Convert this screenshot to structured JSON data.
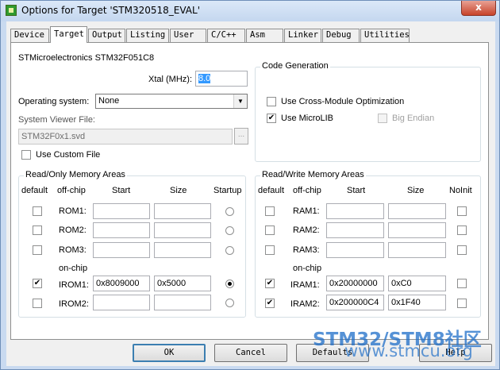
{
  "window": {
    "title": "Options for Target 'STM320518_EVAL'",
    "close_glyph": "x"
  },
  "tabs": [
    {
      "label": "Device",
      "active": false
    },
    {
      "label": "Target",
      "active": true
    },
    {
      "label": "Output",
      "active": false
    },
    {
      "label": "Listing",
      "active": false
    },
    {
      "label": "User",
      "active": false
    },
    {
      "label": "C/C++",
      "active": false
    },
    {
      "label": "Asm",
      "active": false
    },
    {
      "label": "Linker",
      "active": false
    },
    {
      "label": "Debug",
      "active": false
    },
    {
      "label": "Utilities",
      "active": false
    }
  ],
  "target": {
    "device_name": "STMicroelectronics STM32F051C8",
    "xtal_label": "Xtal (MHz):",
    "xtal_value": "8.0",
    "os_label": "Operating system:",
    "os_value": "None",
    "svf_label": "System Viewer File:",
    "svf_value": "STM32F0x1.svd",
    "browse_label": "...",
    "use_custom_file_label": "Use Custom File",
    "use_custom_file_checked": false
  },
  "code_generation": {
    "title": "Code Generation",
    "cross_module_label": "Use Cross-Module Optimization",
    "cross_module_checked": false,
    "microlib_label": "Use MicroLIB",
    "microlib_checked": true,
    "big_endian_label": "Big Endian",
    "big_endian_checked": false
  },
  "rom_areas": {
    "title": "Read/Only Memory Areas",
    "headers": {
      "default": "default",
      "offchip": "off-chip",
      "start": "Start",
      "size": "Size",
      "last": "Startup"
    },
    "onchip_label": "on-chip",
    "rows": [
      {
        "name": "ROM1:",
        "default": false,
        "start": "",
        "size": "",
        "selected": false
      },
      {
        "name": "ROM2:",
        "default": false,
        "start": "",
        "size": "",
        "selected": false
      },
      {
        "name": "ROM3:",
        "default": false,
        "start": "",
        "size": "",
        "selected": false
      },
      {
        "name": "IROM1:",
        "default": true,
        "start": "0x8009000",
        "size": "0x5000",
        "selected": true
      },
      {
        "name": "IROM2:",
        "default": false,
        "start": "",
        "size": "",
        "selected": false
      }
    ]
  },
  "ram_areas": {
    "title": "Read/Write Memory Areas",
    "headers": {
      "default": "default",
      "offchip": "off-chip",
      "start": "Start",
      "size": "Size",
      "last": "NoInit"
    },
    "onchip_label": "on-chip",
    "rows": [
      {
        "name": "RAM1:",
        "default": false,
        "start": "",
        "size": "",
        "noinit": false
      },
      {
        "name": "RAM2:",
        "default": false,
        "start": "",
        "size": "",
        "noinit": false
      },
      {
        "name": "RAM3:",
        "default": false,
        "start": "",
        "size": "",
        "noinit": false
      },
      {
        "name": "IRAM1:",
        "default": true,
        "start": "0x20000000",
        "size": "0xC0",
        "noinit": false
      },
      {
        "name": "IRAM2:",
        "default": true,
        "start": "0x200000C4",
        "size": "0x1F40",
        "noinit": false
      }
    ]
  },
  "buttons": {
    "ok": "OK",
    "cancel": "Cancel",
    "defaults": "Defaults",
    "help": "Help"
  },
  "watermark": {
    "line1": "STM32/STM8社区",
    "line2": "www.stmcu.org"
  }
}
